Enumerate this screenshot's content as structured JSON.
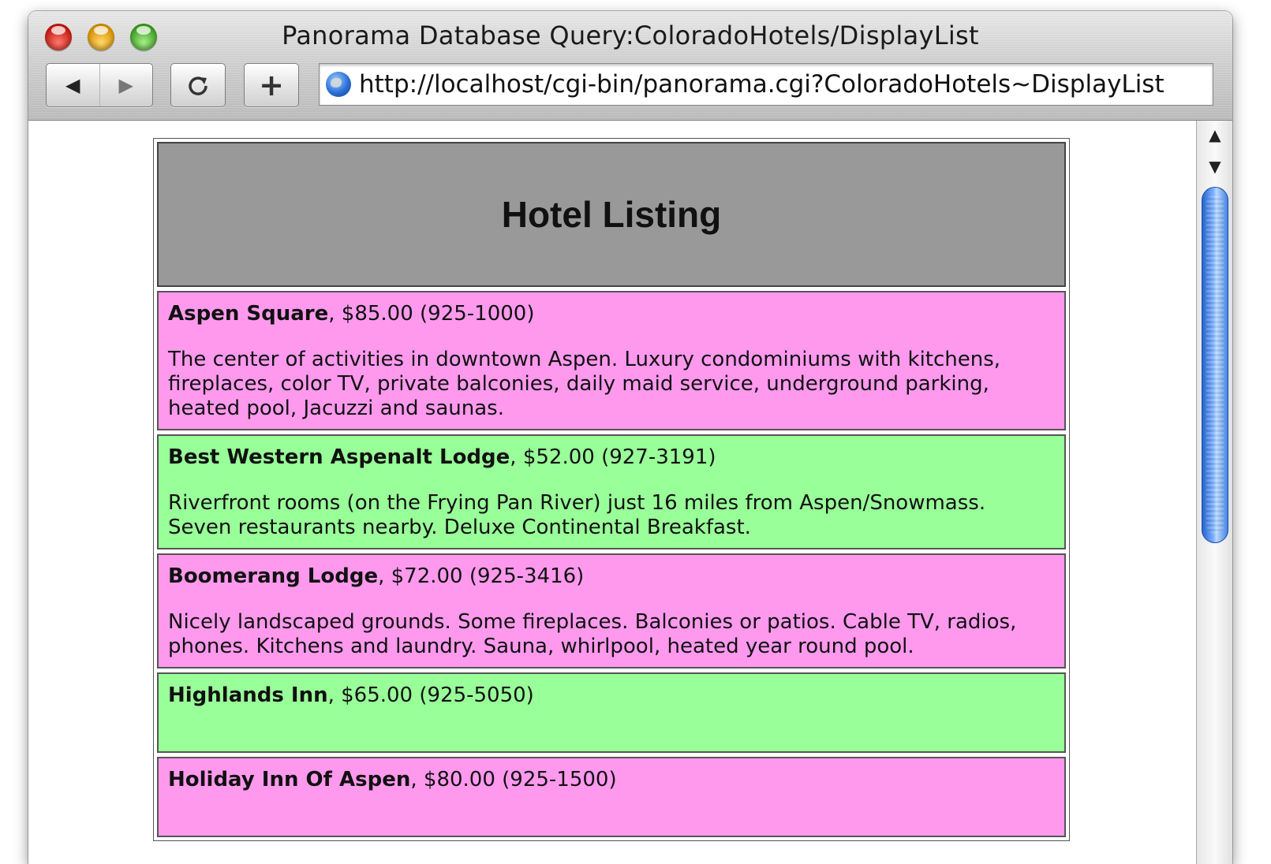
{
  "window": {
    "title": "Panorama Database Query:ColoradoHotels/DisplayList"
  },
  "toolbar": {
    "back_icon": "back-arrow-icon",
    "forward_icon": "forward-arrow-icon",
    "reload_icon": "reload-icon",
    "add_bookmark_label": "+",
    "url": "http://localhost/cgi-bin/panorama.cgi?ColoradoHotels~DisplayList"
  },
  "page": {
    "heading": "Hotel Listing",
    "hotels": [
      {
        "name": "Aspen Square",
        "details": ", $85.00 (925-1000)",
        "description": "The center of activities in downtown Aspen. Luxury condominiums with kitchens, fireplaces, color TV, private balconies, daily maid service, underground parking, heated pool, Jacuzzi and saunas.",
        "color": "#ff99ee"
      },
      {
        "name": "Best Western Aspenalt Lodge",
        "details": ", $52.00 (927-3191)",
        "description": "Riverfront rooms (on the Frying Pan River) just 16 miles from Aspen/Snowmass. Seven restaurants nearby. Deluxe Continental Breakfast.",
        "color": "#99ff99"
      },
      {
        "name": "Boomerang Lodge",
        "details": ", $72.00 (925-3416)",
        "description": "Nicely landscaped grounds. Some fireplaces. Balconies or patios. Cable TV, radios, phones. Kitchens and laundry. Sauna, whirlpool, heated year round pool.",
        "color": "#ff99ee"
      },
      {
        "name": "Highlands Inn",
        "details": ", $65.00 (925-5050)",
        "description": "",
        "color": "#99ff99"
      },
      {
        "name": "Holiday Inn Of Aspen",
        "details": ", $80.00 (925-1500)",
        "description": "",
        "color": "#ff99ee"
      }
    ]
  },
  "colors": {
    "header_bg": "#999999",
    "row_pink": "#ff99ee",
    "row_green": "#99ff99",
    "scroll_thumb": "#3e7ee0"
  }
}
